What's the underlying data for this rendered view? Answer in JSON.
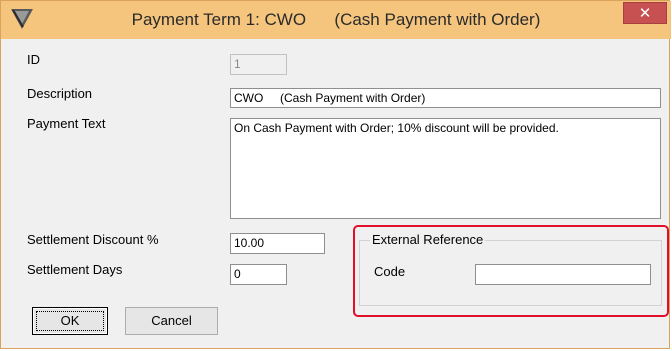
{
  "window": {
    "title": "Payment Term 1: CWO      (Cash Payment with Order)",
    "close_glyph": "✕",
    "app_icon": "app-logo-icon"
  },
  "form": {
    "id_label": "ID",
    "id_value": "1",
    "description_label": "Description",
    "description_value": "CWO     (Cash Payment with Order)",
    "payment_text_label": "Payment Text",
    "payment_text_value": "On Cash Payment with Order; 10% discount will be provided.",
    "settlement_discount_label": "Settlement Discount %",
    "settlement_discount_value": "10.00",
    "settlement_days_label": "Settlement Days",
    "settlement_days_value": "0"
  },
  "external_reference": {
    "legend": "External Reference",
    "code_label": "Code",
    "code_value": ""
  },
  "buttons": {
    "ok": "OK",
    "cancel": "Cancel"
  },
  "colors": {
    "titlebar": "#f5c57e",
    "close": "#c75050",
    "highlight": "#e0102a"
  }
}
